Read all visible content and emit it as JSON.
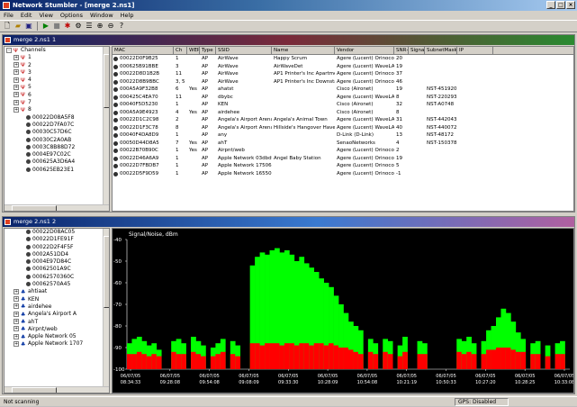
{
  "app": {
    "title": "Network Stumbler - [merge 2.ns1]"
  },
  "menu": [
    "File",
    "Edit",
    "View",
    "Options",
    "Window",
    "Help"
  ],
  "toolbar_icons": [
    "new-icon",
    "open-icon",
    "save-icon",
    "play-icon",
    "stop-icon",
    "scan-icon",
    "options-icon",
    "list-icon",
    "zoom-in-icon",
    "zoom-out-icon",
    "help-icon"
  ],
  "win1": {
    "title": "merge 2.ns1 1"
  },
  "win2": {
    "title": "merge 2.ns1 2"
  },
  "tree1": {
    "root": "Channels",
    "channels": [
      "1",
      "2",
      "3",
      "4",
      "5",
      "6",
      "7",
      "8"
    ],
    "macs": [
      "00022D08A5F8",
      "00022D7FA07C",
      "00030C57D6C",
      "00030C2A0AB",
      "0003C8B88D72",
      "0004E97C02C",
      "000625A3D6A4",
      "000625EB23E1"
    ]
  },
  "tree2": {
    "macs": [
      "00022D08AC05",
      "00022D1FE91F",
      "00022D2F4F5F",
      "0002A51DD4",
      "0004E97D84C",
      "00062501A9C",
      "00062570360C",
      "00062570A45"
    ],
    "ssids": [
      "ahtiaat",
      "KEN",
      "airdehee",
      "Angela's Airport A",
      "ahT",
      "Airpnt/web",
      "Apple Network 05",
      "Apple Network 1707"
    ]
  },
  "table": {
    "columns": [
      "MAC",
      "Ch",
      "WEP",
      "Type",
      "SSID",
      "Name",
      "Vendor",
      "SNR+",
      "Signal+",
      "SubnetMask",
      "IP"
    ],
    "rows": [
      [
        "00022D0F9B25",
        "1",
        "",
        "AP",
        "AirWave",
        "Happy Scrum",
        "Agere (Lucent) Orinoco",
        "20",
        "",
        ""
      ],
      [
        "000625B91BBE",
        "3",
        "",
        "AP",
        "AirWave",
        "AirWaveDet",
        "Agere (Lucent) WaveLAN",
        "19",
        "",
        ""
      ],
      [
        "00022D8D1B2B",
        "11",
        "",
        "AP",
        "AirWave",
        "AP1 Printer's Inc Apartment",
        "Agere (Lucent) Orinoco",
        "37",
        "",
        ""
      ],
      [
        "00022D8B9BBC",
        "3, 5",
        "",
        "AP",
        "AirWave",
        "AP1 Printer's Inc Downstairs",
        "Agere (Lucent) Orinoco",
        "46",
        "",
        ""
      ],
      [
        "000A5A9F32B8",
        "6",
        "Yes",
        "AP",
        "ahatst",
        "",
        "Cisco (Aironet)",
        "19",
        "",
        "NST-451920"
      ],
      [
        "000425C4EA70",
        "11",
        "",
        "AP",
        "dbybc",
        "",
        "Agere (Lucent) WaveLAN",
        "8",
        "",
        "NST-220293"
      ],
      [
        "00040F5D5230",
        "1",
        "",
        "AP",
        "KEN",
        "",
        "Cisco (Aironet)",
        "32",
        "",
        "NST-A0748"
      ],
      [
        "000A5A9E4923",
        "4",
        "Yes",
        "AP",
        "airdehee",
        "",
        "Cisco (Aironet)",
        "8",
        "",
        ""
      ],
      [
        "00022D1C2C98",
        "2",
        "",
        "AP",
        "Angela's Airport Arena",
        "Angela's Animal Town",
        "Agere (Lucent) WaveLAN",
        "31",
        "",
        "NST-442043"
      ],
      [
        "00022D1F3C78",
        "8",
        "",
        "AP",
        "Angela's Airport Arena",
        "Hillside's Hangover Haven",
        "Agere (Lucent) WaveLAN",
        "40",
        "",
        "NST-440072"
      ],
      [
        "00040F4DA8D9",
        "1",
        "",
        "AP",
        "any",
        "",
        "D-Link (D-Link)",
        "13",
        "",
        "NST-48172"
      ],
      [
        "00050D44D8A5",
        "7",
        "Yes",
        "AP",
        "ahT",
        "",
        "SenaoNetworks",
        "4",
        "",
        "NST-150378"
      ],
      [
        "00022B70B90C",
        "1",
        "Yes",
        "AP",
        "Airpnt/web",
        "",
        "Agere (Lucent) Orinoco",
        "2",
        "",
        ""
      ],
      [
        "00022D46A6A9",
        "1",
        "",
        "AP",
        "Apple Network 03dbdf",
        "Angel Baby Station",
        "Agere (Lucent) Orinoco",
        "19",
        "",
        ""
      ],
      [
        "00022D7FBDB7",
        "1",
        "",
        "AP",
        "Apple Network 175067",
        "",
        "Agere (Lucent) Orinoco",
        "5",
        "",
        ""
      ],
      [
        "00022D5F9D59",
        "1",
        "",
        "AP",
        "Apple Network 16550",
        "",
        "Agere (Lucent) Orinoco",
        "-1",
        "",
        ""
      ]
    ]
  },
  "chart_data": {
    "type": "area",
    "title": "Signal/Noise, dBm",
    "ylim": [
      -100,
      -40
    ],
    "ytick_labels": [
      "-40",
      "-50",
      "-60",
      "-70",
      "-80",
      "-90",
      "-100"
    ],
    "xtick_labels": [
      [
        "06/07/05",
        "08:34:33"
      ],
      [
        "06/07/05",
        "09:28:08"
      ],
      [
        "06/07/05",
        "09:54:08"
      ],
      [
        "06/07/05",
        "09:08:09"
      ],
      [
        "06/07/05",
        "09:33:30"
      ],
      [
        "06/07/05",
        "10:28:09"
      ],
      [
        "06/07/05",
        "10:54:08"
      ],
      [
        "06/07/05",
        "10:21:19"
      ],
      [
        "06/07/05",
        "10:50:33"
      ],
      [
        "06/07/05",
        "10:27:20"
      ],
      [
        "06/07/05",
        "10:28:25"
      ],
      [
        "06/07/05",
        "10:33:08"
      ]
    ],
    "series": [
      {
        "name": "signal",
        "color": "#00ff00"
      },
      {
        "name": "noise",
        "color": "#ff0000"
      }
    ],
    "signal": [
      -88,
      -86,
      -85,
      -87,
      -89,
      -88,
      -91,
      -100,
      -100,
      -87,
      -86,
      -88,
      -100,
      -85,
      -87,
      -89,
      -100,
      -90,
      -88,
      -86,
      -100,
      -87,
      -89,
      -100,
      -100,
      -52,
      -48,
      -46,
      -47,
      -45,
      -44,
      -46,
      -45,
      -47,
      -50,
      -48,
      -51,
      -53,
      -55,
      -58,
      -60,
      -62,
      -66,
      -70,
      -74,
      -78,
      -80,
      -82,
      -100,
      -86,
      -88,
      -100,
      -86,
      -87,
      -100,
      -89,
      -85,
      -100,
      -100,
      -87,
      -88,
      -100,
      -100,
      -100,
      -100,
      -100,
      -100,
      -86,
      -87,
      -85,
      -88,
      -100,
      -87,
      -82,
      -80,
      -76,
      -72,
      -74,
      -78,
      -83,
      -86,
      -100,
      -88,
      -87,
      -100,
      -89,
      -100,
      -88,
      -87,
      -100
    ],
    "noise": [
      -93,
      -93,
      -92,
      -93,
      -94,
      -93,
      -94,
      -100,
      -100,
      -92,
      -93,
      -93,
      -100,
      -92,
      -93,
      -94,
      -100,
      -94,
      -93,
      -92,
      -100,
      -93,
      -94,
      -100,
      -100,
      -88,
      -88,
      -89,
      -88,
      -88,
      -88,
      -89,
      -88,
      -88,
      -89,
      -88,
      -88,
      -89,
      -88,
      -88,
      -89,
      -88,
      -89,
      -90,
      -90,
      -91,
      -92,
      -93,
      -100,
      -92,
      -93,
      -100,
      -92,
      -93,
      -100,
      -94,
      -92,
      -100,
      -100,
      -93,
      -93,
      -100,
      -100,
      -100,
      -100,
      -100,
      -100,
      -92,
      -93,
      -92,
      -93,
      -100,
      -93,
      -91,
      -91,
      -90,
      -90,
      -90,
      -91,
      -92,
      -92,
      -100,
      -93,
      -93,
      -100,
      -94,
      -100,
      -93,
      -93,
      -100
    ]
  },
  "status": {
    "left": "Not scanning",
    "right": "GPS: Disabled"
  }
}
